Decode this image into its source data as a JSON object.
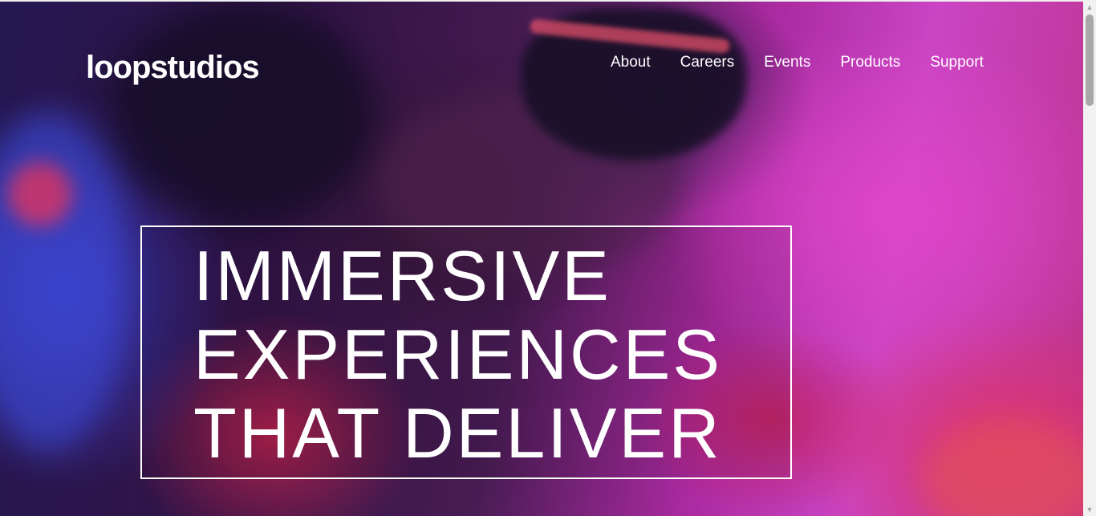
{
  "header": {
    "logo_text": "loopstudios",
    "nav": [
      "About",
      "Careers",
      "Events",
      "Products",
      "Support"
    ]
  },
  "hero": {
    "headline_lines": [
      "IMMERSIVE",
      "EXPERIENCES",
      "THAT DELIVER"
    ]
  },
  "colors": {
    "text": "#ffffff",
    "hero_pink": "#e64fe0",
    "hero_purple": "#2a1b5e"
  },
  "icons": {
    "scroll_up": "triangle-up-icon",
    "scroll_down": "triangle-down-icon"
  }
}
